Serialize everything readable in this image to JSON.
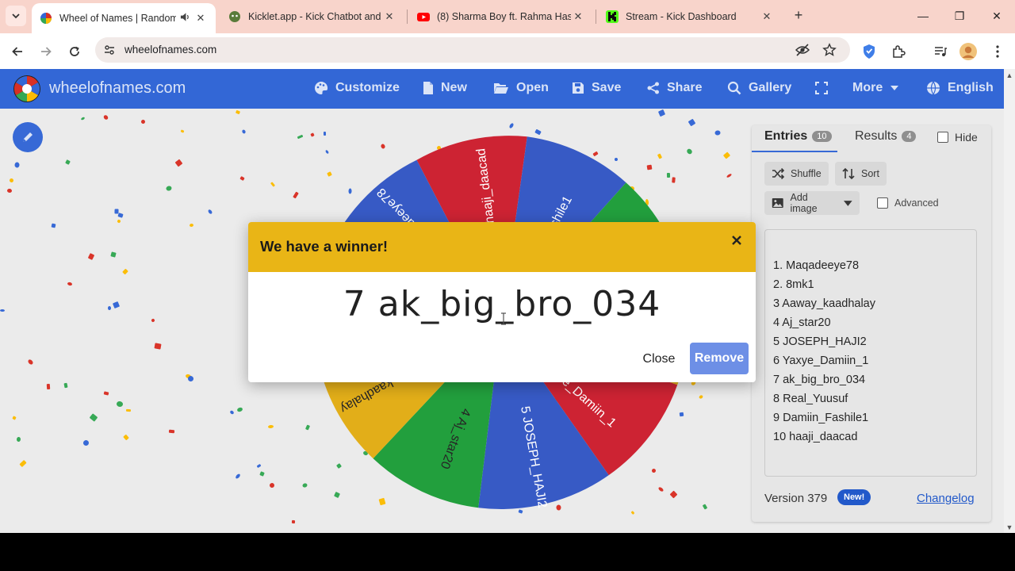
{
  "browser": {
    "tabs": [
      {
        "title": "Wheel of Names | Random",
        "active": true,
        "audio": true
      },
      {
        "title": "Kicklet.app - Kick Chatbot and",
        "active": false
      },
      {
        "title": "(8) Sharma Boy ft. Rahma Hassa",
        "active": false
      },
      {
        "title": "Stream - Kick Dashboard",
        "active": false
      }
    ],
    "new_tab": "+",
    "url": "wheelofnames.com"
  },
  "site": {
    "brand": "wheelofnames.com",
    "nav": {
      "customize": "Customize",
      "new": "New",
      "open": "Open",
      "save": "Save",
      "share": "Share",
      "gallery": "Gallery",
      "more": "More",
      "language": "English"
    }
  },
  "wheel": {
    "visible_labels": [
      "haaji_daacad",
      "Damiin_Fashile1",
      "Maqadeeye78",
      "5 JOSEPH_HAJI2",
      "6 Yaxye_Damiin_1",
      "4 Aj_star20",
      "Aaway_kaadhalay"
    ],
    "colors": {
      "red": "#cc1f2f",
      "blue": "#3457c4",
      "green": "#1e9e3a",
      "yellow": "#e2ad15"
    }
  },
  "panel": {
    "tabs": {
      "entries_label": "Entries",
      "entries_count": "10",
      "results_label": "Results",
      "results_count": "4",
      "hide_label": "Hide"
    },
    "shuffle": "Shuffle",
    "sort": "Sort",
    "add_image": "Add image",
    "advanced": "Advanced",
    "entries": [
      "1. Maqadeeye78",
      "2. 8mk1",
      "3 Aaway_kaadhalay",
      "4 Aj_star20",
      "5 JOSEPH_HAJI2",
      "6 Yaxye_Damiin_1",
      "7 ak_big_bro_034",
      "8 Real_Yuusuf",
      "9 Damiin_Fashile1",
      "10 haaji_daacad"
    ],
    "version": "Version 379",
    "new_badge": "New!",
    "changelog": "Changelog"
  },
  "dialog": {
    "title": "We have a winner!",
    "winner": "7 ak_big_bro_034",
    "close": "Close",
    "remove": "Remove",
    "header_color": "#e9b516"
  }
}
